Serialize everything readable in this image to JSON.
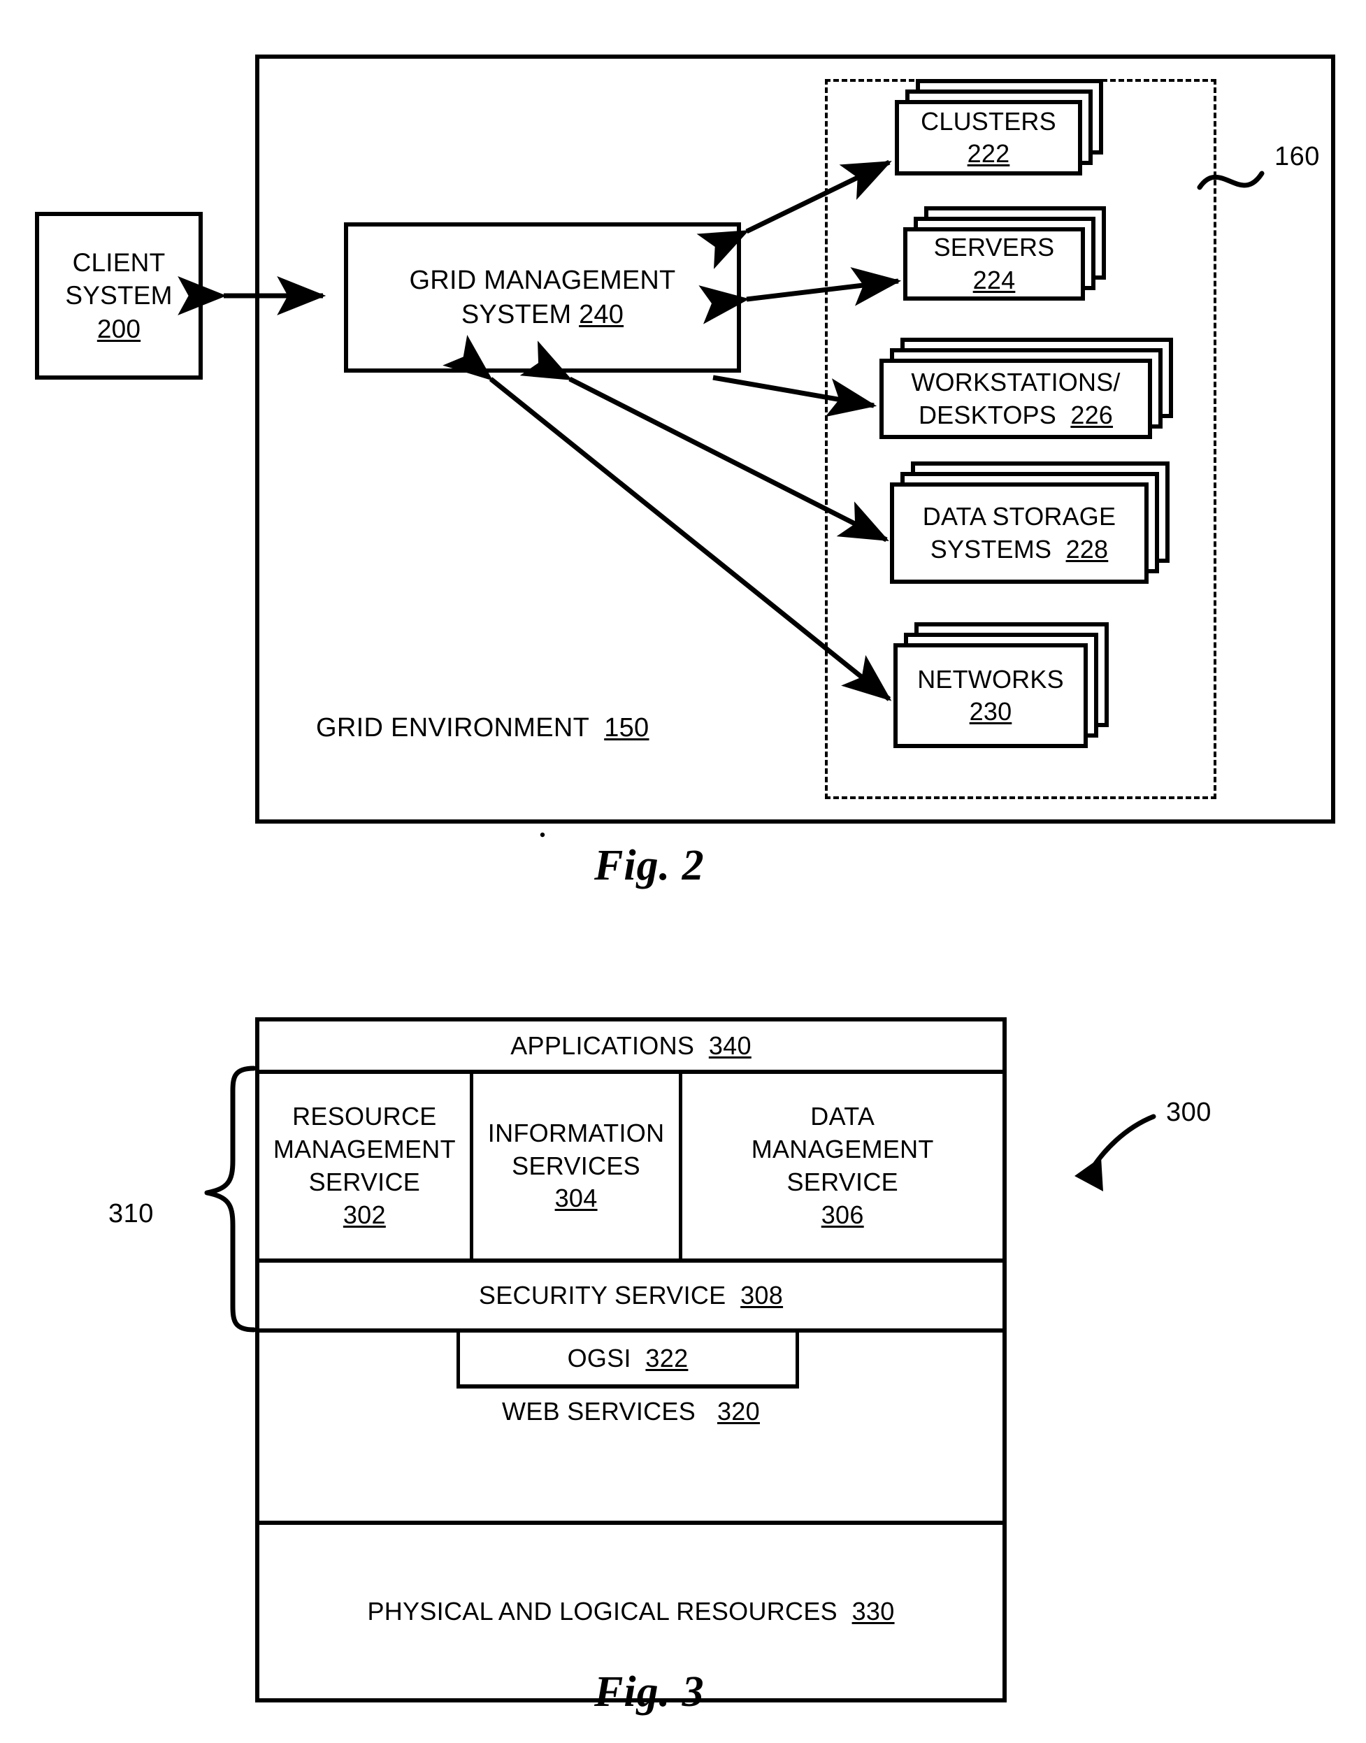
{
  "figures": [
    {
      "caption": "Fig. 2",
      "environment_label": {
        "text": "GRID ENVIRONMENT",
        "number": "150"
      },
      "reference": "160",
      "nodes": [
        {
          "name": "client-system",
          "line1": "CLIENT",
          "line2": "SYSTEM",
          "number": "200"
        },
        {
          "name": "grid-management-system",
          "line1": "GRID MANAGEMENT",
          "line2": "SYSTEM",
          "number": "240"
        }
      ],
      "resources": [
        {
          "name": "clusters",
          "line1": "CLUSTERS",
          "line2": "",
          "number": "222"
        },
        {
          "name": "servers",
          "line1": "SERVERS",
          "line2": "",
          "number": "224"
        },
        {
          "name": "workstations",
          "line1": "WORKSTATIONS/",
          "line2": "DESKTOPS",
          "number": "226"
        },
        {
          "name": "data-storage",
          "line1": "DATA STORAGE",
          "line2": "SYSTEMS",
          "number": "228"
        },
        {
          "name": "networks",
          "line1": "NETWORKS",
          "line2": "",
          "number": "230"
        }
      ]
    },
    {
      "caption": "Fig. 3",
      "reference_brace": "310",
      "reference_arrow": "300",
      "rows": {
        "applications": {
          "label": "APPLICATIONS",
          "number": "340"
        },
        "services": [
          {
            "name": "resource-management-service",
            "line1": "RESOURCE",
            "line2": "MANAGEMENT",
            "line3": "SERVICE",
            "number": "302"
          },
          {
            "name": "information-services",
            "line1": "INFORMATION",
            "line2": "SERVICES",
            "line3": "",
            "number": "304"
          },
          {
            "name": "data-management-service",
            "line1": "DATA",
            "line2": "MANAGEMENT",
            "line3": "SERVICE",
            "number": "306"
          }
        ],
        "security": {
          "label": "SECURITY SERVICE",
          "number": "308"
        },
        "ogsi": {
          "label": "OGSI",
          "number": "322"
        },
        "web": {
          "label": "WEB SERVICES",
          "number": "320"
        },
        "physical": {
          "label": "PHYSICAL AND LOGICAL RESOURCES",
          "number": "330"
        }
      }
    }
  ],
  "colors": {
    "ink": "#000000",
    "paper": "#ffffff"
  }
}
